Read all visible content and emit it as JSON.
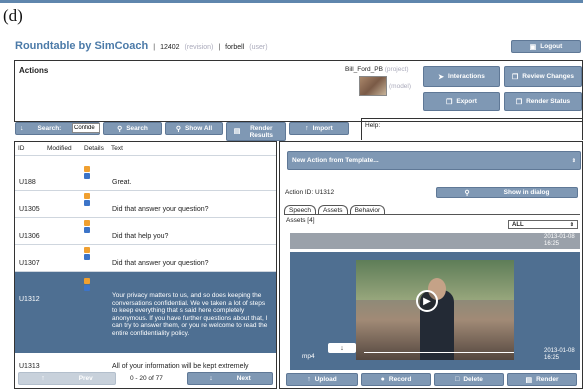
{
  "figure_label": "(d)",
  "header": {
    "brand": "Roundtable by SimCoach",
    "sep": "|",
    "revision_num": "12402",
    "revision_tag": "(revision)",
    "user_name": "forbell",
    "user_tag": "(user)",
    "logout_label": "Logout"
  },
  "actions_panel": {
    "title": "Actions",
    "project_name": "Bill_Ford_PB",
    "project_tag": "(project)",
    "model_tag": "(model)",
    "buttons": {
      "interactions": "Interactions",
      "review_changes": "Review Changes",
      "export": "Export",
      "render_status": "Render Status"
    }
  },
  "toolbar": {
    "search_label": "Search:",
    "search_value": "Confide",
    "search_btn": "Search",
    "show_all": "Show All",
    "render_results": "Render Results",
    "import": "Import",
    "help_label": "Help:"
  },
  "table": {
    "headers": [
      "ID",
      "Modified",
      "Details",
      "Text"
    ],
    "rows": [
      {
        "id": "U188",
        "text": "Great.",
        "selected": false
      },
      {
        "id": "U1305",
        "text": "Did that answer your question?",
        "selected": false
      },
      {
        "id": "U1306",
        "text": "Did that help you?",
        "selected": false
      },
      {
        "id": "U1307",
        "text": "Did that answer your question?",
        "selected": false
      },
      {
        "id": "U1312",
        "text": "Your privacy matters to us, and so does keeping the conversations confidential. We ve taken a lot of steps to keep everything that s said here completely anonymous. If you have further questions about that, I can try to answer them, or you re welcome to read the entire confidentiality policy.",
        "selected": true
      },
      {
        "id": "U1313",
        "text": "All of your information will be kept extremely",
        "selected": false
      }
    ],
    "prev_label": "Prev",
    "page_info": "0 - 20 of 77",
    "next_label": "Next"
  },
  "detail": {
    "new_action_placeholder": "New Action from Template...",
    "action_id_label": "Action ID: U1312",
    "show_dialog": "Show in dialog",
    "tabs": [
      "Speech",
      "Assets",
      "Behavior"
    ],
    "active_tab": "Assets",
    "assets_count": "Assets [4]",
    "filter_value": "ALL",
    "asset_date_1": "2013-01-08",
    "asset_time_1": "16:25",
    "asset_type": "mp4",
    "asset_date_2": "2013-01-08",
    "asset_time_2": "16:25",
    "buttons": {
      "upload": "Upload",
      "record": "Record",
      "delete": "Delete",
      "render": "Render"
    }
  },
  "colors": {
    "brand": "#4b7aa8",
    "button": "#7f98b4",
    "selected_row": "#4e6f92",
    "badge_orange": "#f0a030",
    "badge_blue": "#3c74c8"
  }
}
